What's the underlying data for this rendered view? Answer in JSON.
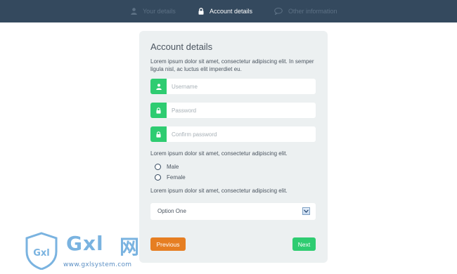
{
  "nav": {
    "steps": [
      {
        "label": "Your details",
        "icon": "user-icon",
        "active": false
      },
      {
        "label": "Account details",
        "icon": "lock-icon",
        "active": true
      },
      {
        "label": "Other information",
        "icon": "speech-bubble-icon",
        "active": false
      }
    ]
  },
  "form": {
    "title": "Account details",
    "intro": "Lorem ipsum dolor sit amet, consectetur adipiscing elit. In semper ligula nisl, ac luctus elit imperdiet eu.",
    "fields": [
      {
        "placeholder": "Username",
        "value": "",
        "icon": "user-icon"
      },
      {
        "placeholder": "Password",
        "value": "",
        "icon": "lock-icon"
      },
      {
        "placeholder": "Confirm password",
        "value": "",
        "icon": "lock-icon"
      }
    ],
    "gender_text": "Lorem ipsum dolor sit amet, consectetur adipiscing elit.",
    "radios": [
      {
        "label": "Male",
        "checked": false
      },
      {
        "label": "Female",
        "checked": false
      }
    ],
    "select_text": "Lorem ipsum dolor sit amet, consectetur adipiscing elit.",
    "select": {
      "selected": "Option One"
    },
    "buttons": {
      "previous": "Previous",
      "next": "Next"
    }
  },
  "colors": {
    "topbar": "#34495e",
    "accent_green": "#2ecc71",
    "accent_orange": "#e67e22",
    "card": "#ecf0f1"
  },
  "watermark": {
    "brand": "Gxl",
    "brand_cn": "网",
    "shield_text": "Gxl",
    "url": "www.gxlsystem.com"
  }
}
